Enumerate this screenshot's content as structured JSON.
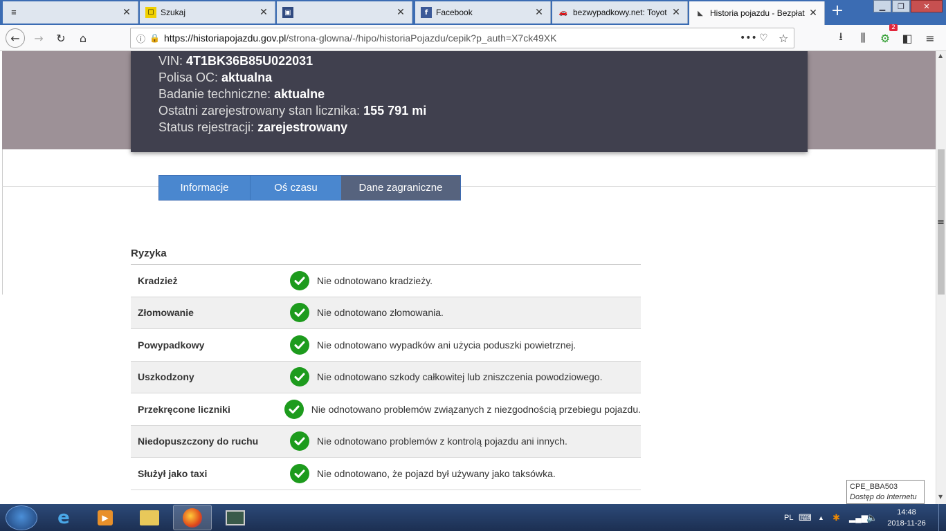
{
  "browser": {
    "tabs": [
      {
        "title": "",
        "icon": "menu-icon"
      },
      {
        "title": "Szukaj",
        "icon": "yellow-logo-icon"
      },
      {
        "title": "",
        "icon": "app-icon"
      },
      {
        "title": "Facebook",
        "icon": "facebook-icon"
      },
      {
        "title": "bezwypadkowy.net: Toyot",
        "icon": "car-icon"
      },
      {
        "title": "Historia pojazdu - Bezpłat",
        "icon": "history-icon"
      }
    ],
    "url_domain": "https://historiapojazdu.gov.pl",
    "url_path": "/strona-glowna/-/hipo/historiaPojazdu/cepik?p_auth=X7ck49XK",
    "notification_count": "2"
  },
  "vehicle": {
    "vin_label": "VIN:",
    "vin_value": "4T1BK36B85U022031",
    "oc_label": "Polisa OC:",
    "oc_value": "aktualna",
    "inspection_label": "Badanie techniczne:",
    "inspection_value": "aktualne",
    "odometer_label": "Ostatni zarejestrowany stan licznika:",
    "odometer_value": "155 791 mi",
    "status_label": "Status rejestracji:",
    "status_value": "zarejestrowany"
  },
  "page_tabs": [
    "Informacje",
    "Oś czasu",
    "Dane zagraniczne"
  ],
  "risks": {
    "title": "Ryzyka",
    "rows": [
      {
        "label": "Kradzież",
        "value": "Nie odnotowano kradzieży."
      },
      {
        "label": "Złomowanie",
        "value": "Nie odnotowano złomowania."
      },
      {
        "label": "Powypadkowy",
        "value": "Nie odnotowano wypadków ani użycia poduszki powietrznej."
      },
      {
        "label": "Uszkodzony",
        "value": "Nie odnotowano szkody całkowitej lub zniszczenia powodziowego."
      },
      {
        "label": "Przekręcone liczniki",
        "value": "Nie odnotowano problemów związanych z niezgodnością przebiegu pojazdu."
      },
      {
        "label": "Niedopuszczony do ruchu",
        "value": "Nie odnotowano problemów z kontrolą pojazdu ani innych."
      },
      {
        "label": "Służył jako taxi",
        "value": "Nie odnotowano, że pojazd był używany jako taksówka."
      }
    ]
  },
  "tooltip": {
    "line1": "CPE_BBA503",
    "line2": "Dostęp do Internetu"
  },
  "taskbar": {
    "language": "PL",
    "time": "14:48",
    "date": "2018-11-26"
  }
}
